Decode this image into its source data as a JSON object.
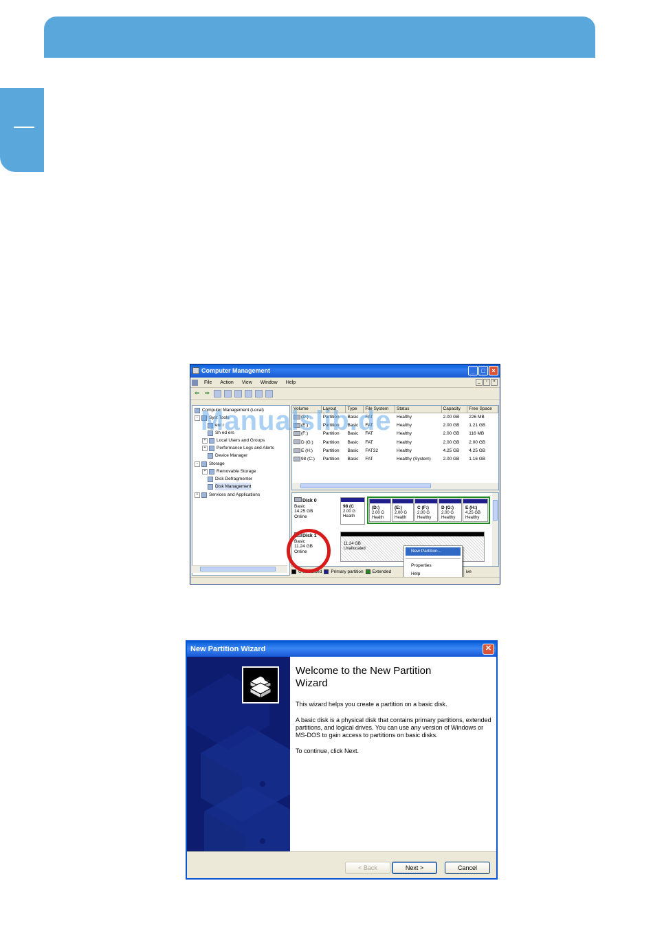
{
  "page": {
    "watermark": "Manualslib.de"
  },
  "computer_management": {
    "title": "Computer Management",
    "menu": [
      "File",
      "Action",
      "View",
      "Window",
      "Help"
    ],
    "tree": [
      {
        "label": "Computer Management (Local)",
        "level": 0
      },
      {
        "label": "Syst   Tools",
        "level": 1
      },
      {
        "label": "   ent   r",
        "level": 2
      },
      {
        "label": "Sh   ed   ers",
        "level": 2
      },
      {
        "label": "Local Users and Groups",
        "level": 2
      },
      {
        "label": "Performance Logs and Alerts",
        "level": 2
      },
      {
        "label": "Device Manager",
        "level": 2
      },
      {
        "label": "Storage",
        "level": 1
      },
      {
        "label": "Removable Storage",
        "level": 2
      },
      {
        "label": "Disk Defragmenter",
        "level": 2
      },
      {
        "label": "Disk Management",
        "level": 2,
        "selected": true
      },
      {
        "label": "Services and Applications",
        "level": 1
      }
    ],
    "volume_headers": [
      "Volume",
      "Layout",
      "Type",
      "File System",
      "Status",
      "Capacity",
      "Free Space"
    ],
    "volumes": [
      [
        "(D:)",
        "Partition",
        "Basic",
        "FAT",
        "Healthy",
        "2.00 GB",
        "226 MB"
      ],
      [
        "(E:)",
        "Partition",
        "Basic",
        "FAT",
        "Healthy",
        "2.00 GB",
        "1.21 GB"
      ],
      [
        "(F:)",
        "Partition",
        "Basic",
        "FAT",
        "Healthy",
        "2.00 GB",
        "116 MB"
      ],
      [
        "D (G:)",
        "Partition",
        "Basic",
        "FAT",
        "Healthy",
        "2.00 GB",
        "2.00 GB"
      ],
      [
        "E (H:)",
        "Partition",
        "Basic",
        "FAT32",
        "Healthy",
        "4.25 GB",
        "4.25 GB"
      ],
      [
        "98 (C:)",
        "Partition",
        "Basic",
        "FAT",
        "Healthy (System)",
        "2.00 GB",
        "1.16 GB"
      ]
    ],
    "disk0": {
      "name": "Disk 0",
      "type": "Basic",
      "size": "14.25 GB",
      "state": "Online",
      "partitions": [
        {
          "name": "98 (C",
          "size": "2.00 G",
          "status": "Health"
        },
        {
          "name": "(D:)",
          "size": "2.00 G",
          "status": "Health"
        },
        {
          "name": "(E:)",
          "size": "2.00 G",
          "status": "Health"
        },
        {
          "name": "C (F:)",
          "size": "2.00 G",
          "status": "Healthy"
        },
        {
          "name": "D (G:)",
          "size": "2.00 G",
          "status": "Healthy"
        },
        {
          "name": "E (H:)",
          "size": "4.25 GB",
          "status": "Healthy"
        }
      ]
    },
    "disk1": {
      "name": "Disk 1",
      "type": "Basic",
      "size": "11.24 GB",
      "state": "Online",
      "unalloc_size": "11.24 GB",
      "unalloc_label": "Unallocated"
    },
    "legend": [
      "Unallocated",
      "Primary partition",
      "Extended",
      "ive"
    ],
    "context_menu": [
      "New Partition...",
      "Properties",
      "Help"
    ],
    "colors": {
      "unallocated": "#000000",
      "primary": "#1e1e8c",
      "extended": "#1f8a1f",
      "free": "#8fd88f"
    }
  },
  "wizard": {
    "title": "New Partition Wizard",
    "heading_line1": "Welcome to the New Partition",
    "heading_line2": "Wizard",
    "para1": "This wizard helps you create a partition on a basic disk.",
    "para2": "A basic disk is a physical disk that contains primary partitions, extended partitions, and logical drives. You can use any version of Windows or MS-DOS to gain access to partitions on basic disks.",
    "para3": "To continue, click Next.",
    "back_label": "< Back",
    "next_label": "Next >",
    "cancel_label": "Cancel"
  },
  "colors": {
    "banner": "#5aa7dc",
    "xp_title": "#0a5fd8",
    "highlight_circle": "#d71a1a",
    "wizard_side": "#0d1c6e"
  }
}
